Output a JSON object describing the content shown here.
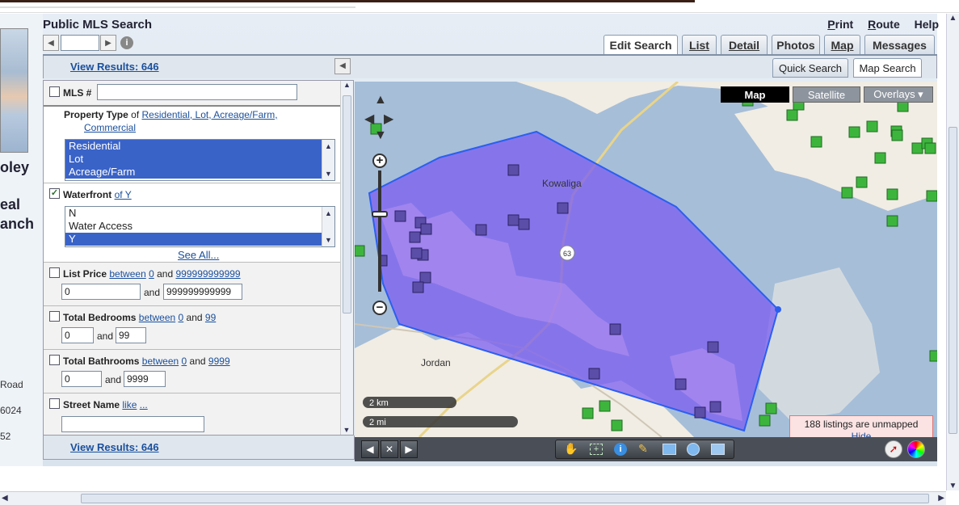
{
  "app": {
    "title": "Public MLS Search"
  },
  "top_menu": [
    {
      "label": "Print",
      "underline": "P",
      "rest": "rint"
    },
    {
      "label": "Route",
      "underline": "R",
      "rest": "oute"
    },
    {
      "label": "Help",
      "underline": "",
      "rest": "Help"
    }
  ],
  "left_panel": {
    "name_fragment": "oley",
    "line2": "eal",
    "line3": "anch",
    "addr1": "Road",
    "addr2": "6024",
    "addr3": "52"
  },
  "pager": {
    "prev": "◀",
    "next": "▶",
    "value": ""
  },
  "tabs": [
    {
      "label": "Edit Search",
      "key": "t",
      "active": true
    },
    {
      "label": "List",
      "key": "L",
      "active": false
    },
    {
      "label": "Detail",
      "key": "D",
      "active": false
    },
    {
      "label": "Photos",
      "key": "o",
      "active": false
    },
    {
      "label": "Map",
      "key": "M",
      "active": false
    },
    {
      "label": "Messages",
      "key": "",
      "active": false
    }
  ],
  "subtabs": [
    {
      "label": "Quick Search",
      "active": false
    },
    {
      "label": "Map Search",
      "active": true
    }
  ],
  "view_results": "View Results: 646",
  "form": {
    "mls": {
      "label": "MLS #",
      "value": "",
      "checked": false
    },
    "property_type": {
      "label": "Property Type",
      "of": "of",
      "value_link": "Residential, Lot, Acreage/Farm,",
      "value_link2": "Commercial",
      "options": [
        "Residential",
        "Lot",
        "Acreage/Farm"
      ],
      "selected": [
        0,
        1,
        2
      ]
    },
    "waterfront": {
      "label": "Waterfront",
      "of_link": "of Y",
      "checked": true,
      "options": [
        "N",
        "Water Access",
        "Y"
      ],
      "selected": [
        2
      ],
      "see_all": "See All..."
    },
    "list_price": {
      "label": "List Price",
      "between": "between",
      "low": "0",
      "and": "and",
      "high": "999999999999",
      "min_value": "0",
      "max_value": "999999999999",
      "checked": false
    },
    "bedrooms": {
      "label": "Total Bedrooms",
      "between": "between",
      "low": "0",
      "and": "and",
      "high": "99",
      "min_value": "0",
      "max_value": "99",
      "checked": false
    },
    "bathrooms": {
      "label": "Total Bathrooms",
      "between": "between",
      "low": "0",
      "and": "and",
      "high": "9999",
      "min_value": "0",
      "max_value": "9999",
      "checked": false
    },
    "street": {
      "label": "Street Name",
      "like": "like",
      "dots": "...",
      "value": "",
      "checked": false
    }
  },
  "map": {
    "types": [
      {
        "label": "Map",
        "active": true
      },
      {
        "label": "Satellite",
        "active": false
      },
      {
        "label": "Overlays ▾",
        "active": false
      }
    ],
    "places": [
      "Kowaliga",
      "Jordan"
    ],
    "route_label": "63",
    "scale": [
      "2 km",
      "2 mi"
    ],
    "unmapped_text": "188 listings are unmapped",
    "hide_label": "Hide",
    "colors": {
      "polygon": "#7b5cf0",
      "land": "#f1ede4",
      "water": "#a6bed8",
      "marker_purple": "#5b4ea8",
      "marker_green": "#3db53d"
    }
  },
  "toolbar_icons": [
    "prev-icon",
    "fullscreen-icon",
    "next-icon",
    "hand-icon",
    "zoom-box-icon",
    "info-icon",
    "lasso-icon",
    "rectangle-icon",
    "circle-icon",
    "folder-icon",
    "compass-icon",
    "color-wheel-icon"
  ]
}
